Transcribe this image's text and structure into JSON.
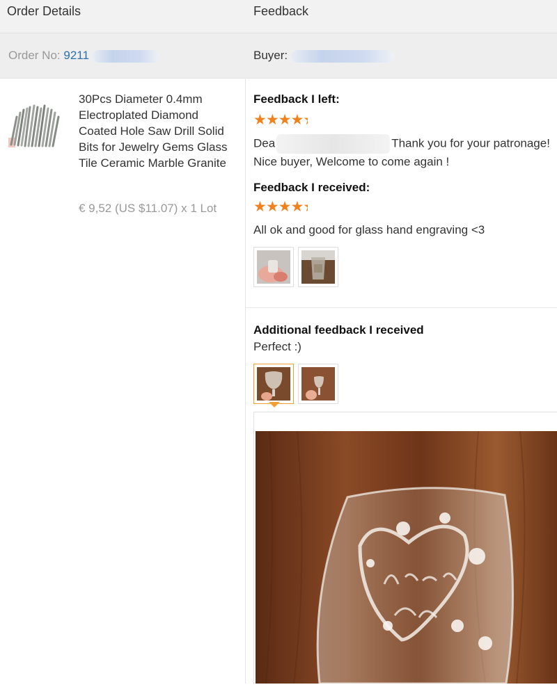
{
  "header": {
    "order_details": "Order Details",
    "feedback": "Feedback"
  },
  "order": {
    "label": "Order No:",
    "number_visible": "9211"
  },
  "buyer": {
    "label": "Buyer:"
  },
  "product": {
    "title": "30Pcs Diameter 0.4mm Electroplated Diamond Coated Hole Saw Drill Solid Bits for Jewelry Gems Glass Tile Ceramic Marble Granite",
    "price": "€ 9,52 (US $11.07) x 1 Lot"
  },
  "feedback_left": {
    "heading": "Feedback I left:",
    "rating_stars": 4.5,
    "text_start": "Dea",
    "text_rest": "Thank you for your patronage! Nice buyer, Welcome to come again !"
  },
  "feedback_received": {
    "heading": "Feedback I received:",
    "rating_stars": 4.5,
    "text": "All ok and good for glass hand engraving <3"
  },
  "additional": {
    "heading": "Additional feedback I received",
    "text": "Perfect :)"
  },
  "colors": {
    "star": "#f0821e",
    "link": "#2d6ead",
    "accent_border": "#f0a030"
  },
  "icons": {
    "star": "star-icon",
    "more": "more-dots-icon"
  }
}
